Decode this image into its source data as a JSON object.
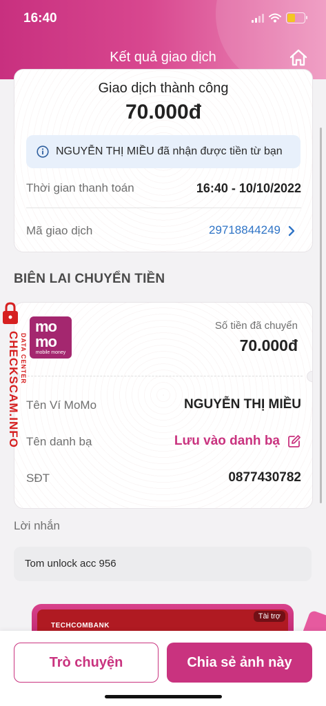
{
  "status_bar": {
    "time": "16:40"
  },
  "header": {
    "title": "Kết quả giao dịch"
  },
  "result": {
    "status": "Giao dịch thành công",
    "amount": "70.000đ",
    "notice": "NGUYỄN THỊ MIỀU đã nhận được tiền từ bạn",
    "paid_time_label": "Thời gian thanh toán",
    "paid_time_value": "16:40 - 10/10/2022",
    "txid_label": "Mã giao dịch",
    "txid_value": "29718844249"
  },
  "receipt": {
    "section_title": "BIÊN LAI CHUYỂN TIỀN",
    "logo_line1": "mo",
    "logo_line2": "mo",
    "logo_caption": "mobile money",
    "sent_label": "Số tiền đã chuyển",
    "sent_amount": "70.000đ",
    "wallet_name_label": "Tên Ví MoMo",
    "wallet_name_value": "NGUYỄN THỊ MIỀU",
    "contact_label": "Tên danh bạ",
    "contact_action": "Lưu vào danh bạ",
    "phone_label": "SĐT",
    "phone_value": "0877430782"
  },
  "message": {
    "label": "Lời nhắn",
    "text": "Tom unlock acc 956"
  },
  "ad": {
    "brand": "TECHCOMBANK",
    "tag": "Tài trợ"
  },
  "actions": {
    "chat": "Trò chuyện",
    "share": "Chia sẻ ảnh này"
  },
  "watermark": {
    "main": "CHECKSCAM.INFO",
    "sub": "DATA CENTER"
  },
  "colors": {
    "brand": "#c9337f",
    "link": "#2f74c6",
    "info_bg": "#e8f0fb"
  }
}
